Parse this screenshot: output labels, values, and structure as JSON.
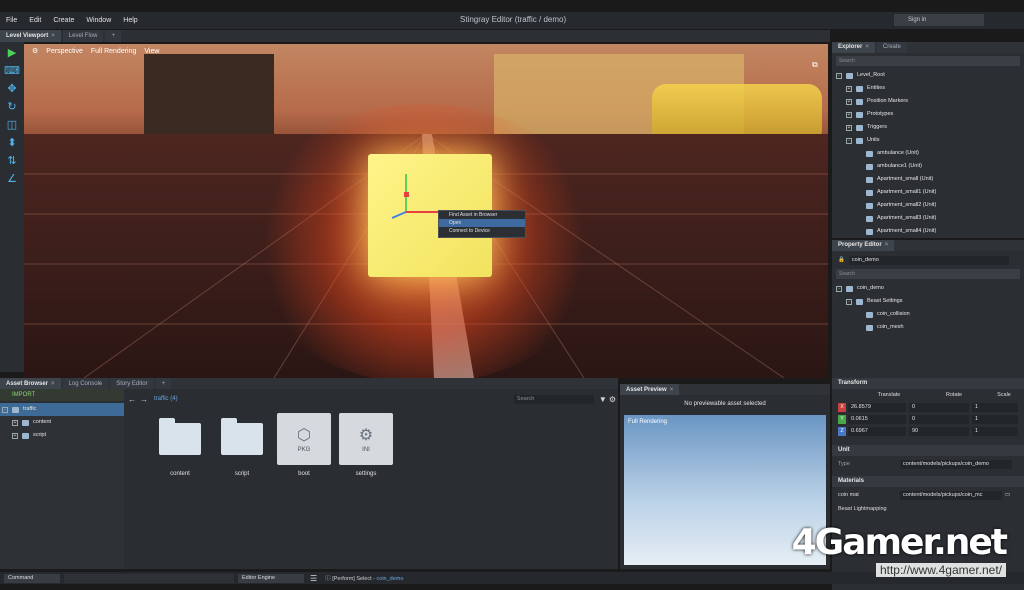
{
  "window": {
    "title": "Stingray Editor (traffic / demo)",
    "menus": [
      "File",
      "Edit",
      "Create",
      "Window",
      "Help"
    ],
    "signin": "Sign in"
  },
  "viewport": {
    "tabs": [
      "Level Viewport",
      "Level Flow"
    ],
    "toolbar": [
      "Perspective",
      "Full Rendering",
      "View"
    ],
    "context_menu": [
      "Find Asset in Browser",
      "Open",
      "Connect to Device"
    ]
  },
  "explorer": {
    "tabs": [
      "Explorer",
      "Create"
    ],
    "search_placeholder": "Search",
    "tree": [
      "Level_Root",
      "Entities",
      "Position Markers",
      "Prototypes",
      "Triggers",
      "Units",
      "ambulance (Unit)",
      "ambulance1 (Unit)",
      "Apartment_small (Unit)",
      "Apartment_small1 (Unit)",
      "Apartment_small2 (Unit)",
      "Apartment_small3 (Unit)",
      "Apartment_small4 (Unit)"
    ]
  },
  "property_editor": {
    "tab": "Property Editor",
    "object_name": "coin_demo",
    "search_placeholder": "Search",
    "tree": [
      "coin_demo",
      "Beast Settings",
      "coin_collision",
      "coin_mesh"
    ],
    "transform": {
      "header": "Transform",
      "columns": [
        "Translate",
        "Rotate",
        "Scale"
      ],
      "rows": [
        {
          "axis": "X",
          "translate": "26.8579",
          "rotate": "0",
          "scale": "1"
        },
        {
          "axis": "Y",
          "translate": "0.0615",
          "rotate": "0",
          "scale": "1"
        },
        {
          "axis": "Z",
          "translate": "0.6967",
          "rotate": "90",
          "scale": "1"
        }
      ]
    },
    "unit": {
      "header": "Unit",
      "type_label": "Type",
      "type_value": "content/models/pickups/coin_demo"
    },
    "materials": {
      "header": "Materials",
      "label": "coin mat",
      "value": "content/models/pickups/coin_mc"
    },
    "lightmapping": "Beast Lightmapping"
  },
  "bottom": {
    "tabs": [
      "Asset Browser",
      "Log Console",
      "Story Editor"
    ],
    "import_label": "IMPORT",
    "folder_tree": [
      "traffic",
      "content",
      "script"
    ],
    "path": "traffic (4)",
    "search_placeholder": "Search",
    "assets": [
      {
        "name": "content",
        "kind": "folder"
      },
      {
        "name": "script",
        "kind": "folder"
      },
      {
        "name": "boot",
        "kind": "file",
        "ext": "PKG"
      },
      {
        "name": "settings",
        "kind": "file",
        "ext": "INI"
      }
    ]
  },
  "preview": {
    "tab": "Asset Preview",
    "message": "No previewable asset selected",
    "rendering_label": "Full Rendering"
  },
  "status": {
    "command_label": "Command",
    "engine_label": "Editor Engine",
    "log_prefix": "[Perform] Select - ",
    "log_target": "coin_demo"
  },
  "watermark": {
    "logo": "4Gamer.net",
    "url": "http://www.4gamer.net/"
  }
}
